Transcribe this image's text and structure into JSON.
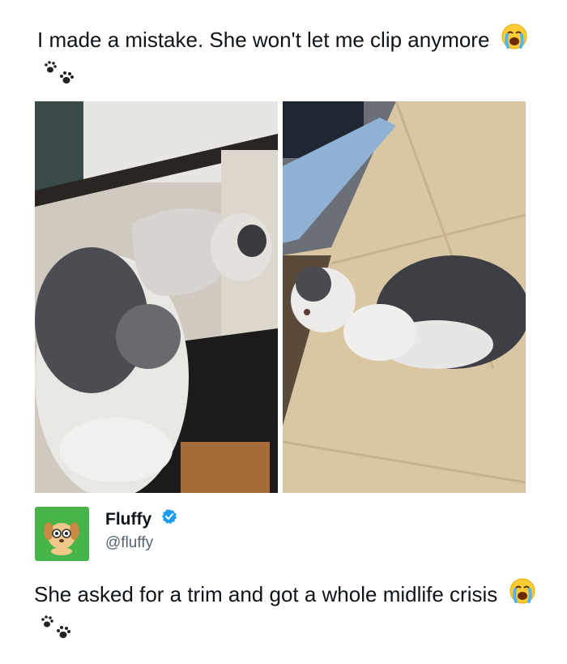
{
  "post": {
    "text": "I made a mistake. She won't let me clip anymore",
    "emojis": [
      "crying-face",
      "paw-prints"
    ]
  },
  "photos": [
    {
      "name": "cat-on-chair-photo"
    },
    {
      "name": "cat-on-tile-floor-photo"
    }
  ],
  "reply": {
    "display_name": "Fluffy",
    "verified": true,
    "handle": "@fluffy",
    "text": "She asked for a trim and got a whole midlife crisis",
    "emojis": [
      "crying-face",
      "paw-prints"
    ]
  },
  "colors": {
    "text": "#0f1419",
    "handle": "#536471",
    "verified": "#1d9bf0",
    "avatar_bg": "#45b549"
  }
}
